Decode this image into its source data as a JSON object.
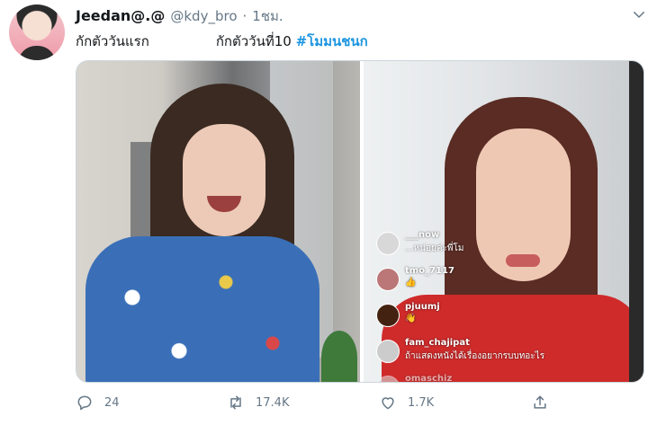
{
  "tweet": {
    "display_name": "Jeedan@.@",
    "handle": "@kdy_bro",
    "separator": "·",
    "time": "1ชม.",
    "text_part1": "กักตัววันแรก",
    "text_part2": "กักตัววันที่10",
    "hashtag": "#โมมนชนก"
  },
  "live_comments": [
    {
      "user": "___now",
      "text": "...หน่อยค่ะพี่โม"
    },
    {
      "user": "tmo_7117",
      "text": "👍"
    },
    {
      "user": "pjuumj",
      "text": "👋"
    },
    {
      "user": "fam_chajipat",
      "text": "ถ้าแสดงหนังได้เรื่องอยากรบบทอะไร"
    },
    {
      "user": "omaschiz",
      "text": ""
    }
  ],
  "actions": {
    "reply_count": "24",
    "retweet_count": "17.4K",
    "like_count": "1.7K"
  },
  "colors": {
    "accent": "#1b95e0",
    "muted": "#657786"
  }
}
